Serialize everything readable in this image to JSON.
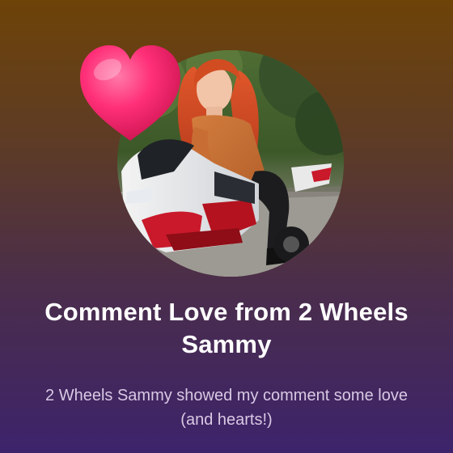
{
  "notification": {
    "title": "Comment Love from 2 Wheels Sammy",
    "subtitle": "2 Wheels Sammy showed my comment some love (and hearts!)",
    "avatar_alt": "2 Wheels Sammy",
    "reaction_icon": "heart-icon"
  },
  "colors": {
    "background_top": "#6e4308",
    "background_bottom": "#3d236b",
    "title": "#ffffff",
    "subtitle": "#d9c9e4",
    "heart": "#ff2f78"
  }
}
